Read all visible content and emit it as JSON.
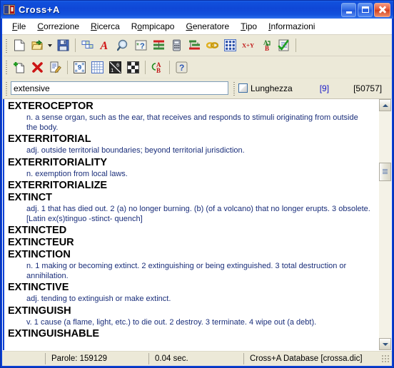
{
  "window": {
    "title": "Cross+A",
    "icon": "book-icon",
    "controls": {
      "minimize": "Minimize",
      "maximize": "Maximize",
      "close": "Close"
    }
  },
  "menubar": {
    "items": [
      {
        "label": "File",
        "accel": "F"
      },
      {
        "label": "Correzione",
        "accel": "C"
      },
      {
        "label": "Ricerca",
        "accel": "R"
      },
      {
        "label": "Rompicapo",
        "accel": "o"
      },
      {
        "label": "Generatore",
        "accel": "G"
      },
      {
        "label": "Tipo",
        "accel": "T"
      },
      {
        "label": "Informazioni",
        "accel": "I"
      }
    ]
  },
  "toolbar_row1": [
    {
      "name": "new-document-icon",
      "type": "button"
    },
    {
      "name": "open-folder-icon",
      "type": "button"
    },
    {
      "name": "open-dropdown-arrow-icon",
      "type": "dropdown"
    },
    {
      "name": "save-disk-icon",
      "type": "button"
    },
    {
      "name": "separator",
      "type": "separator"
    },
    {
      "name": "crossword-grid-icon",
      "type": "button"
    },
    {
      "name": "anagram-letter-a-icon",
      "type": "button"
    },
    {
      "name": "search-magnifier-icon",
      "type": "button"
    },
    {
      "name": "wildcard-pattern-icon",
      "type": "button"
    },
    {
      "name": "word-ladder-icon",
      "type": "button"
    },
    {
      "name": "phone-keypad-icon",
      "type": "button"
    },
    {
      "name": "sorting-lines-icon",
      "type": "button"
    },
    {
      "name": "chain-links-icon",
      "type": "button"
    },
    {
      "name": "letter-matrix-icon",
      "type": "button"
    },
    {
      "name": "x-plus-y-icon",
      "type": "button"
    },
    {
      "name": "a-to-b-convert-icon",
      "type": "button"
    },
    {
      "name": "checklist-check-icon",
      "type": "button"
    },
    {
      "name": "separator",
      "type": "separator"
    }
  ],
  "toolbar_row2": [
    {
      "name": "add-word-icon",
      "type": "button"
    },
    {
      "name": "delete-word-icon",
      "type": "button"
    },
    {
      "name": "edit-word-icon",
      "type": "button"
    },
    {
      "name": "separator",
      "type": "separator"
    },
    {
      "name": "sudoku-grid-icon",
      "type": "button"
    },
    {
      "name": "blank-grid-icon",
      "type": "button"
    },
    {
      "name": "kakuro-grid-icon",
      "type": "button"
    },
    {
      "name": "filled-grid-icon",
      "type": "button"
    },
    {
      "name": "separator",
      "type": "separator"
    },
    {
      "name": "cipher-a-b-icon",
      "type": "button"
    },
    {
      "name": "separator",
      "type": "separator"
    },
    {
      "name": "help-question-icon",
      "type": "button"
    }
  ],
  "search": {
    "value": "extensive",
    "placeholder": "",
    "length_checkbox_label": "Lunghezza",
    "length_checked": false,
    "selected_count": "[9]",
    "total_count": "[50757]"
  },
  "entries": [
    {
      "word": "EXTEROCEPTOR",
      "definition": "n. a sense organ, such as the ear, that receives and responds to stimuli originating from outside the body."
    },
    {
      "word": "EXTERRITORIAL",
      "definition": "adj. outside territorial boundaries; beyond territorial jurisdiction."
    },
    {
      "word": "EXTERRITORIALITY",
      "definition": "n. exemption from local laws."
    },
    {
      "word": "EXTERRITORIALIZE",
      "definition": ""
    },
    {
      "word": "EXTINCT",
      "definition": "adj. 1 that has died out. 2 (a) no longer burning. (b) (of a volcano) that no longer erupts. 3 obsolete. [Latin ex(s)tinguo -stinct- quench]"
    },
    {
      "word": "EXTINCTED",
      "definition": ""
    },
    {
      "word": "EXTINCTEUR",
      "definition": ""
    },
    {
      "word": "EXTINCTION",
      "definition": "n. 1 making or becoming extinct. 2 extinguishing or being extinguished. 3 total destruction or annihilation."
    },
    {
      "word": "EXTINCTIVE",
      "definition": "adj. tending to extinguish or make extinct."
    },
    {
      "word": "EXTINGUISH",
      "definition": "v. 1 cause (a flame, light, etc.) to die out. 2 destroy. 3 terminate. 4 wipe out (a debt)."
    },
    {
      "word": "EXTINGUISHABLE",
      "definition": ""
    }
  ],
  "scrollbar": {
    "up_arrow": "scroll-up-icon",
    "down_arrow": "scroll-down-icon"
  },
  "statusbar": {
    "words": "Parole: 159129",
    "time": "0.04 sec.",
    "database": "Cross+A Database [crossa.dic]"
  },
  "colors": {
    "titlebar": "#0f47d6",
    "client": "#ece9d8",
    "entry_word": "#000000",
    "entry_def": "#1a2e7a",
    "count_selected": "#1515c8"
  }
}
